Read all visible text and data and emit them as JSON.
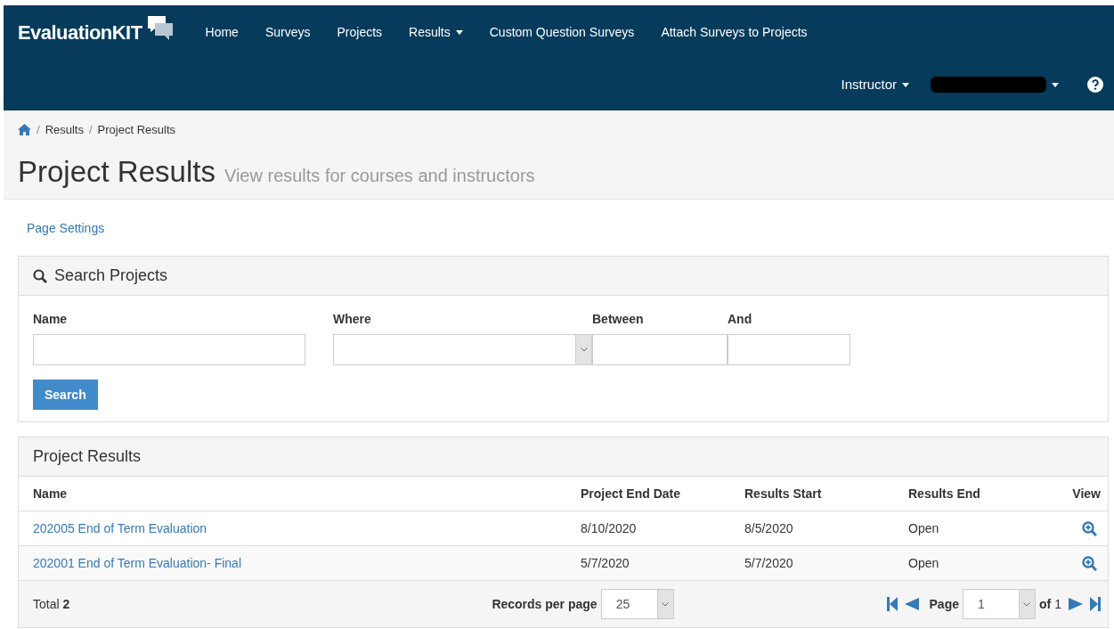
{
  "brand": "EvaluationKIT",
  "nav": [
    {
      "label": "Home",
      "dropdown": false
    },
    {
      "label": "Surveys",
      "dropdown": false
    },
    {
      "label": "Projects",
      "dropdown": false
    },
    {
      "label": "Results",
      "dropdown": true
    },
    {
      "label": "Custom Question Surveys",
      "dropdown": false
    },
    {
      "label": "Attach Surveys to Projects",
      "dropdown": false
    }
  ],
  "user_menu": {
    "role": "Instructor"
  },
  "breadcrumb": [
    {
      "separator": "/",
      "label": "Results"
    },
    {
      "separator": "/",
      "label": "Project Results"
    }
  ],
  "page": {
    "title": "Project Results",
    "subtitle": "View results for courses and instructors"
  },
  "page_settings_link": "Page Settings",
  "search_panel": {
    "title": "Search Projects",
    "fields": [
      {
        "label": "Name",
        "kind": "text"
      },
      {
        "label": "Where",
        "kind": "select"
      },
      {
        "label": "Between",
        "kind": "text"
      },
      {
        "label": "And",
        "kind": "text"
      }
    ],
    "button": "Search"
  },
  "results_panel": {
    "title": "Project Results",
    "columns": [
      "Name",
      "Project End Date",
      "Results Start",
      "Results End",
      "View"
    ],
    "rows": [
      {
        "name": "202005 End of Term Evaluation",
        "end_date": "8/10/2020",
        "results_start": "8/5/2020",
        "results_end": "Open"
      },
      {
        "name": "202001 End of Term Evaluation- Final",
        "end_date": "5/7/2020",
        "results_start": "5/7/2020",
        "results_end": "Open"
      }
    ],
    "total_label": "Total",
    "total": "2",
    "records_label": "Records per page",
    "records_value": "25",
    "page_label": "Page",
    "page_value": "1",
    "of_label": "of",
    "page_count": "1"
  }
}
